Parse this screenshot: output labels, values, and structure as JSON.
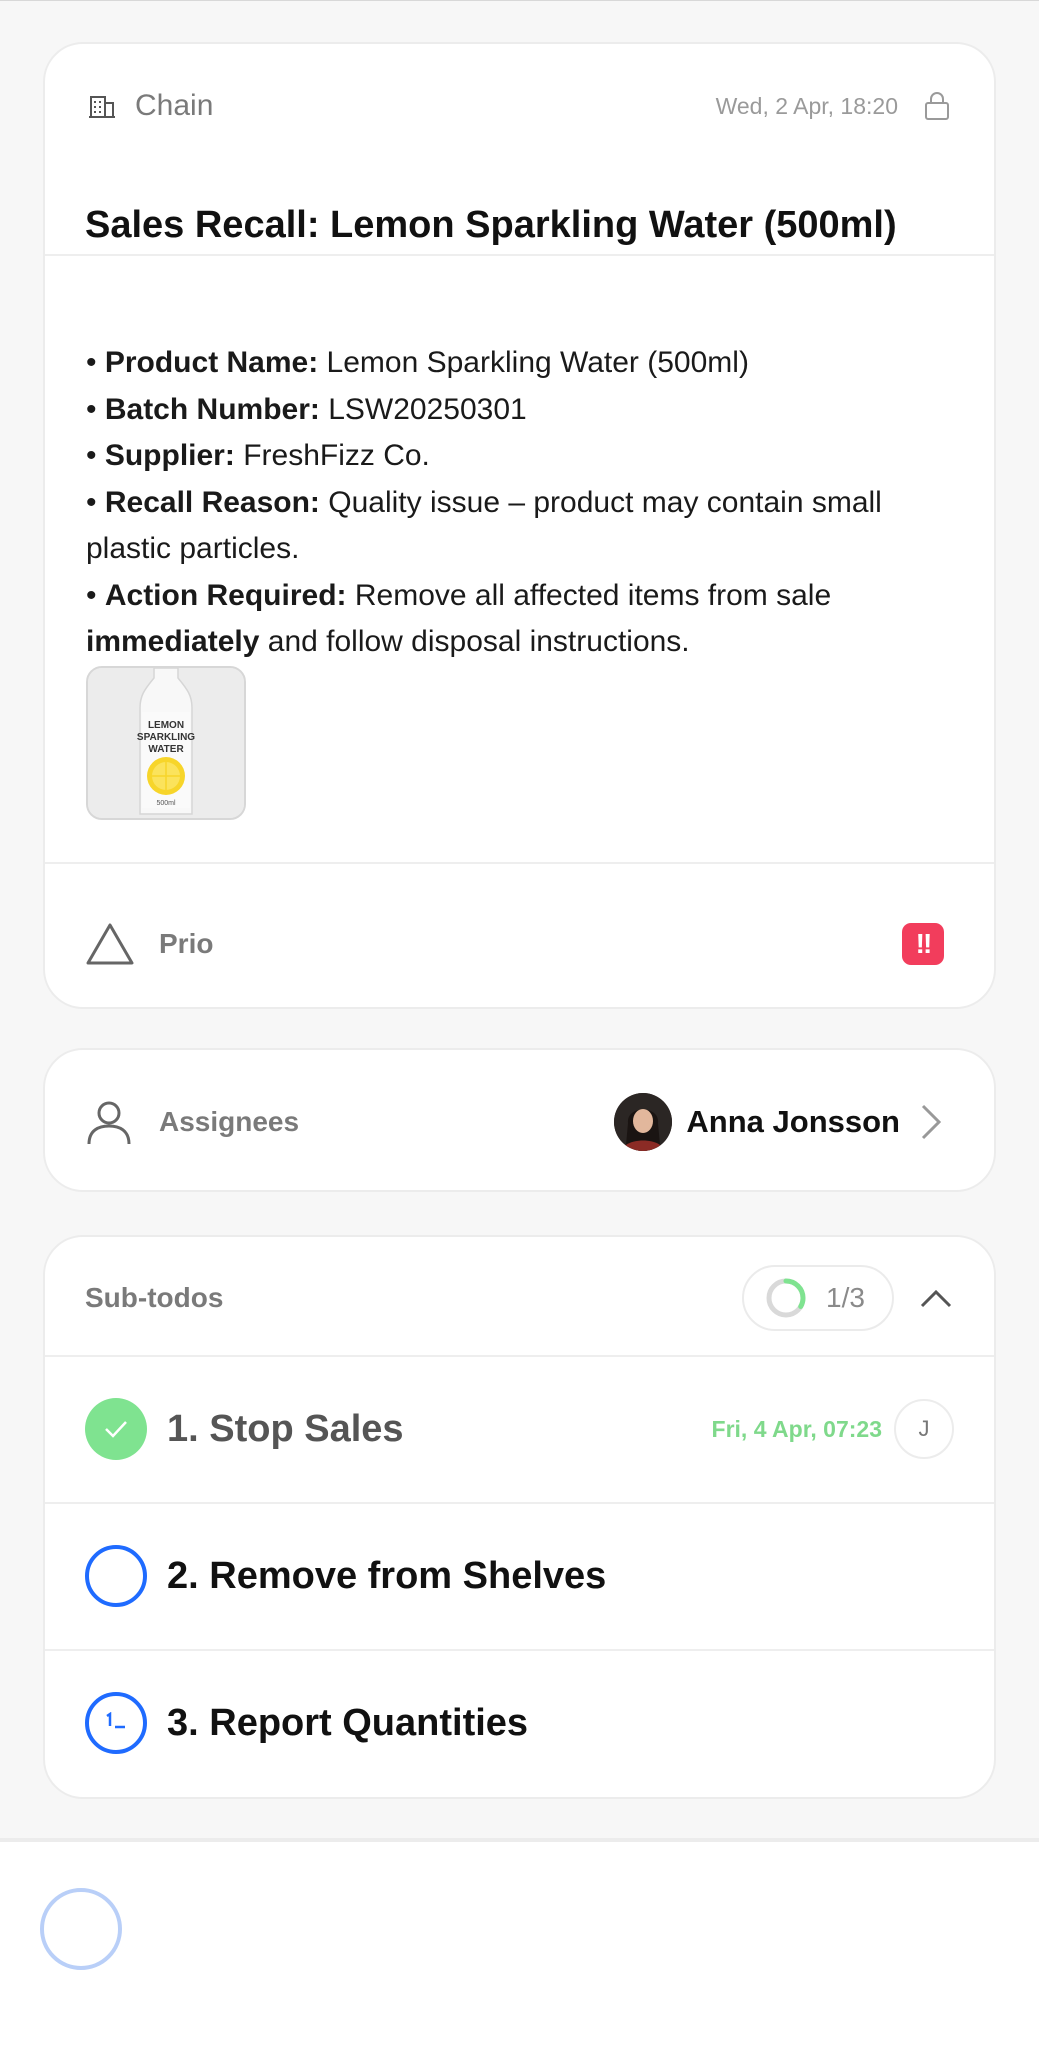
{
  "header": {
    "chain_label": "Chain",
    "date": "Wed, 2 Apr, 18:20",
    "title": "Sales Recall: Lemon Sparkling Water (500ml)"
  },
  "details": {
    "product_name_label": "Product Name:",
    "product_name_value": " Lemon Sparkling Water (500ml)",
    "batch_label": "Batch Number:",
    "batch_value": " LSW20250301",
    "supplier_label": "Supplier:",
    "supplier_value": " FreshFizz Co.",
    "reason_label": "Recall Reason:",
    "reason_value": " Quality issue – product may contain small plastic particles.",
    "action_label": "Action Required:",
    "action_value_1": " Remove all affected items from sale ",
    "action_bold": "immediately",
    "action_value_2": " and follow disposal instructions.",
    "bullet": "• ",
    "product_image_text": [
      "LEMON",
      "SPARKLING",
      "WATER"
    ],
    "product_image_volume": "500ml"
  },
  "priority": {
    "label": "Prio",
    "badge": "!!",
    "badge_color": "#f23d5c"
  },
  "assignees": {
    "label": "Assignees",
    "name": "Anna Jonsson"
  },
  "subtodos": {
    "label": "Sub-todos",
    "progress_text": "1/3",
    "progress_fraction": 0.333,
    "items": [
      {
        "label": "1. Stop Sales",
        "done": true,
        "date": "Fri, 4 Apr, 07:23",
        "user_initial": "J"
      },
      {
        "label": "2. Remove from Shelves",
        "done": false
      },
      {
        "label": "3. Report Quantities",
        "done": false,
        "partial_icon": "1_"
      }
    ]
  },
  "colors": {
    "accent_blue": "#1f6bff",
    "done_green": "#7fe390",
    "date_green": "#7fd98b"
  }
}
